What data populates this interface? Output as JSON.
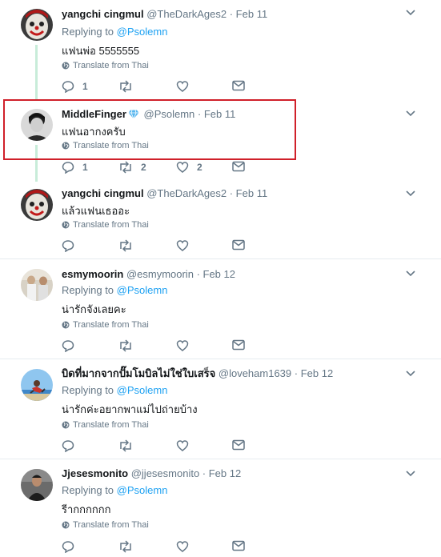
{
  "thread": {
    "line_color": "#c8ecd9"
  },
  "highlight": {
    "color": "#d0202a"
  },
  "tweets": [
    {
      "name": "yangchi cingmul",
      "handle": "@TheDarkAges2",
      "date": "· Feb 11",
      "replying_prefix": "Replying to ",
      "replying_to": "@Psolemn",
      "text": "แฟนพ่อ 5555555",
      "translate": "Translate from Thai",
      "reply_count": "1",
      "retweet_count": "",
      "like_count": ""
    },
    {
      "name": "MiddleFinger",
      "handle": "@Psolemn",
      "date": "· Feb 11",
      "verified_icon": "diamond-icon",
      "text": "แฟนอากงครับ",
      "translate": "Translate from Thai",
      "reply_count": "1",
      "retweet_count": "2",
      "like_count": "2"
    },
    {
      "name": "yangchi cingmul",
      "handle": "@TheDarkAges2",
      "date": "· Feb 11",
      "text": "แล้วแฟนเธออะ",
      "translate": "Translate from Thai",
      "reply_count": "",
      "retweet_count": "",
      "like_count": ""
    },
    {
      "name": "esmymoorin",
      "handle": "@esmymoorin",
      "date": "· Feb 12",
      "replying_prefix": "Replying to ",
      "replying_to": "@Psolemn",
      "text": "น่ารักจังเลยคะ",
      "translate": "Translate from Thai",
      "reply_count": "",
      "retweet_count": "",
      "like_count": ""
    },
    {
      "name": "บิดที่มากจากปั๊มโมบิลไม่ใช่ใบเสร็จ",
      "handle": "@loveham1639",
      "date": "· Feb 12",
      "replying_prefix": "Replying to ",
      "replying_to": "@Psolemn",
      "text": "น่ารักค่ะอยากพาแม่ไปถ่ายบ้าง",
      "translate": "Translate from Thai",
      "reply_count": "",
      "retweet_count": "",
      "like_count": ""
    },
    {
      "name": "Jjesesmonito",
      "handle": "@jjesesmonito",
      "date": "· Feb 12",
      "replying_prefix": "Replying to ",
      "replying_to": "@Psolemn",
      "text": "รีากกกกกก",
      "translate": "Translate from Thai",
      "reply_count": "",
      "retweet_count": "",
      "like_count": ""
    }
  ]
}
